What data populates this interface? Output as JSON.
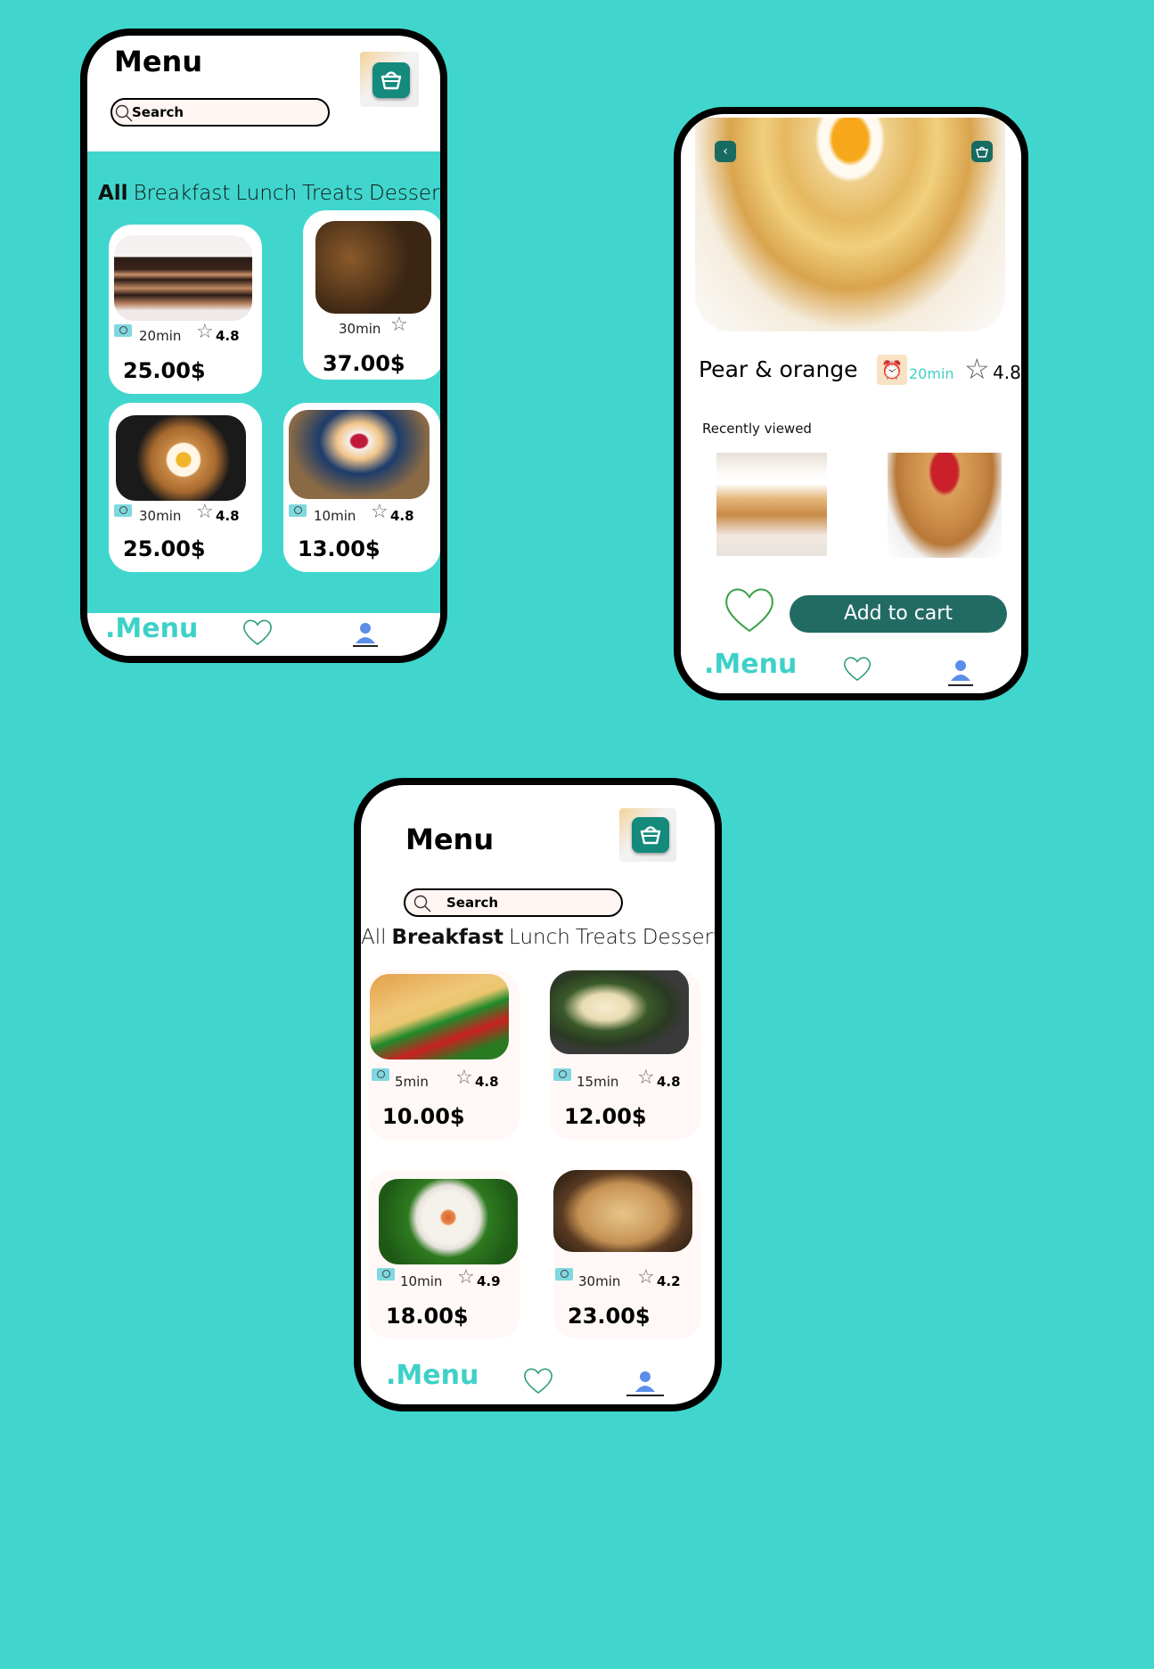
{
  "colors": {
    "background": "#40d6cd",
    "accent": "#3ed1c8",
    "basket": "#148a7c",
    "cart_button": "#226b63"
  },
  "phone1": {
    "title": "Menu",
    "search_placeholder": "Search",
    "tabs": [
      "All",
      "Breakfast",
      "Lunch",
      "Treats",
      "Desserts"
    ],
    "active_tab": "All",
    "items": [
      {
        "time": "20min",
        "rating": "4.8",
        "price": "25.00$",
        "image": "chocolate-cake"
      },
      {
        "time": "30min",
        "rating": "",
        "price": "37.00$",
        "image": "mushroom-stir-fry"
      },
      {
        "time": "30min",
        "rating": "4.8",
        "price": "25.00$",
        "image": "egg-in-toast"
      },
      {
        "time": "10min",
        "rating": "4.8",
        "price": "13.00$",
        "image": "pancakes-berries"
      }
    ],
    "nav": {
      "brand": ".Menu",
      "icons": [
        "heart-icon",
        "user-icon"
      ]
    }
  },
  "phone2": {
    "item_name": "Pear & orange",
    "time": "20min",
    "rating": "4.8",
    "recently_viewed_label": "Recently viewed",
    "recent": [
      "apple-pie-ice-cream",
      "strawberry-pancakes"
    ],
    "add_to_cart": "Add to cart",
    "nav": {
      "brand": ".Menu"
    }
  },
  "phone3": {
    "title": "Menu",
    "search_placeholder": "Search",
    "tabs": [
      "All",
      "Breakfast",
      "Lunch",
      "Treats",
      "Desserts"
    ],
    "active_tab": "Breakfast",
    "items": [
      {
        "time": "5min",
        "rating": "4.8",
        "price": "10.00$",
        "image": "dosa"
      },
      {
        "time": "15min",
        "rating": "4.8",
        "price": "12.00$",
        "image": "upma"
      },
      {
        "time": "10min",
        "rating": "4.9",
        "price": "18.00$",
        "image": "idli"
      },
      {
        "time": "30min",
        "rating": "4.2",
        "price": "23.00$",
        "image": "paratha"
      }
    ],
    "nav": {
      "brand": ".Menu"
    }
  }
}
